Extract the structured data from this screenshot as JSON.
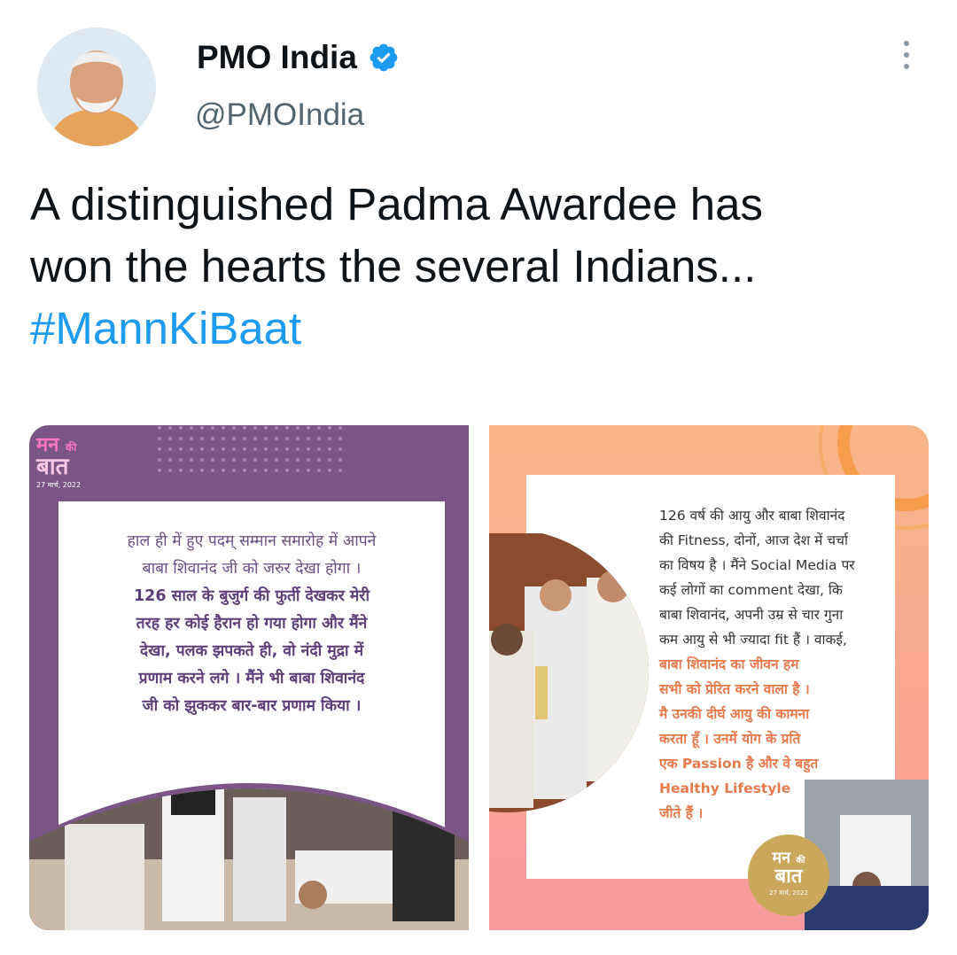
{
  "header": {
    "name": "PMO India",
    "handle": "@PMOIndia",
    "avatar_icon": "profile-photo",
    "verified_icon": "verified-badge-icon",
    "more_icon": "more-options-icon",
    "colors": {
      "verified": "#1d9bf0",
      "hashtag": "#1d9bf0"
    }
  },
  "tweet": {
    "line1": "A distinguished Padma Awardee has",
    "line2": "won the hearts the several Indians...",
    "hashtag": "#MannKiBaat"
  },
  "images": [
    {
      "logo_top": "मन",
      "logo_small": "की",
      "logo_bottom": "बात",
      "date": "27 मार्च, 2022",
      "text_normal": [
        "हाल ही में हुए पदम् सम्मान समारोह में आपने",
        "बाबा शिवानंद जी को जरुर देखा होगा ।"
      ],
      "text_bold": [
        "126 साल के बुजुर्ग की फुर्ती देखकर मेरी",
        "तरह हर कोई हैरान हो गया होगा और मैंने",
        "देखा, पलक झपकते ही, वो नंदी मुद्रा में",
        "प्रणाम करने लगे । मैंने भी बाबा शिवानंद",
        "जी को झुककर बार-बार प्रणाम किया ।"
      ],
      "background": "#7b5585"
    },
    {
      "text_normal": [
        "126 वर्ष की आयु और बाबा शिवानंद",
        "की Fitness, दोनों, आज देश में चर्चा",
        "का विषय है । मैंने Social Media पर",
        "कई लोगों का comment देखा, कि",
        "बाबा शिवानंद, अपनी उम्र से चार गुना",
        "कम आयु से भी ज्यादा fit हैं । वाकई,"
      ],
      "text_highlight": [
        "बाबा शिवानंद का जीवन हम",
        "सभी को प्रेरित करने वाला है ।",
        "मै उनकी दीर्घ आयु की कामना",
        "करता हूँ । उनमें योग के प्रति",
        "एक Passion है और वे बहुत",
        "Healthy Lifestyle",
        "जीते हैं ।"
      ],
      "logo_top": "मन",
      "logo_small": "की",
      "logo_bottom": "बात",
      "date": "27 मार्च, 2022",
      "background": "#f9b58a",
      "highlight_color": "#e77a4c"
    }
  ]
}
